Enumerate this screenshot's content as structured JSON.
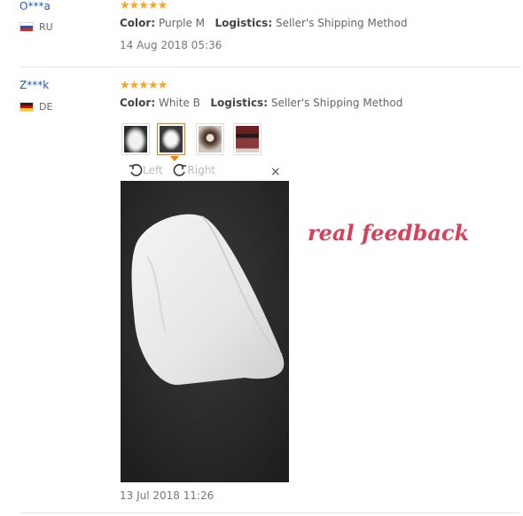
{
  "reviews": [
    {
      "user": "O***a",
      "country": "RU",
      "stars": "★★★★★",
      "color_label": "Color:",
      "color_value": "Purple M",
      "logistics_label": "Logistics:",
      "logistics_value": "Seller's Shipping Method",
      "date": "14 Aug 2018 05:36"
    },
    {
      "user": "Z***k",
      "country": "DE",
      "stars": "★★★★★",
      "color_label": "Color:",
      "color_value": "White B",
      "logistics_label": "Logistics:",
      "logistics_value": "Seller's Shipping Method",
      "date": "13 Jul 2018 11:26"
    }
  ],
  "viewer": {
    "rotate_left_label": "Left",
    "rotate_right_label": "Right",
    "close": "×"
  },
  "overlay_text": "real feedback",
  "colors": {
    "star": "#f5a623",
    "username": "#1f5db8",
    "selected_thumb": "#f07c0a",
    "overlay": "#d8415a"
  }
}
